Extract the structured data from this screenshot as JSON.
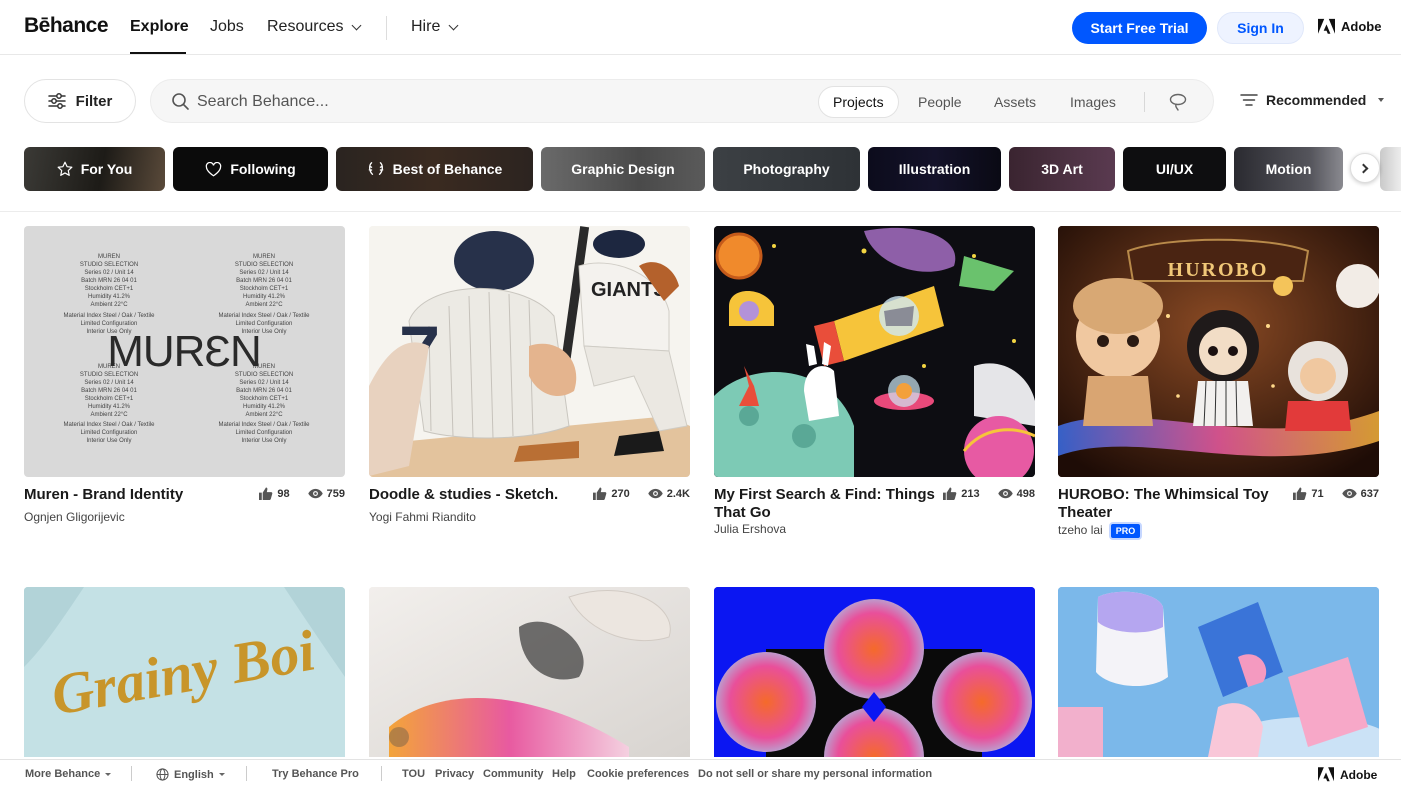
{
  "nav": {
    "logo": "Bēhance",
    "links": [
      "Explore",
      "Jobs",
      "Resources",
      "Hire"
    ],
    "start_trial": "Start Free Trial",
    "sign_in": "Sign In",
    "adobe": "Adobe"
  },
  "search": {
    "filter_label": "Filter",
    "placeholder": "Search Behance...",
    "tabs": [
      "Projects",
      "People",
      "Assets",
      "Images"
    ],
    "active_tab": "Projects",
    "sort_label": "Recommended"
  },
  "categories": [
    "For You",
    "Following",
    "Best of Behance",
    "Graphic Design",
    "Photography",
    "Illustration",
    "3D Art",
    "UI/UX",
    "Motion"
  ],
  "projects": [
    {
      "title": "Muren - Brand Identity",
      "author": "Ognjen Gligorijevic",
      "likes": "98",
      "views": "759",
      "pro": ""
    },
    {
      "title": "Doodle & studies - Sketch.",
      "author": "Yogi Fahmi Riandito",
      "likes": "270",
      "views": "2.4K",
      "pro": ""
    },
    {
      "title_line1": "My First Search & Find: Things",
      "title_line2": "That Go",
      "author": "Julia Ershova",
      "likes": "213",
      "views": "498",
      "pro": ""
    },
    {
      "title_line1": "HUROBO: The Whimsical Toy",
      "title_line2": "Theater",
      "author": "tzeho lai",
      "likes": "71",
      "views": "637",
      "pro": "PRO"
    }
  ],
  "thumb_text": {
    "muren_word": "MURƐN",
    "muren_block": [
      "MUREN",
      "STUDIO SELECTION",
      "Series 02 / Unit 14",
      "Batch MRN 26 04 01",
      "Stockholm CET+1",
      "Humidity 41.2%",
      "Ambient 22°C"
    ],
    "muren_block2": [
      "Material Index Steel / Oak / Textile",
      "Limited Configuration",
      "Interior Use Only"
    ],
    "hurobo_sign": "HUROBO",
    "grainy": "Grainy Boi",
    "jersey_no": "7",
    "jersey_team": "GIANTS"
  },
  "footer": {
    "more": "More Behance",
    "lang": "English",
    "pro": "Try Behance Pro",
    "links": [
      "TOU",
      "Privacy",
      "Community",
      "Help",
      "Cookie preferences",
      "Do not sell or share my personal information"
    ],
    "adobe": "Adobe"
  },
  "colors": {
    "accent": "#0057ff",
    "text": "#191919"
  }
}
